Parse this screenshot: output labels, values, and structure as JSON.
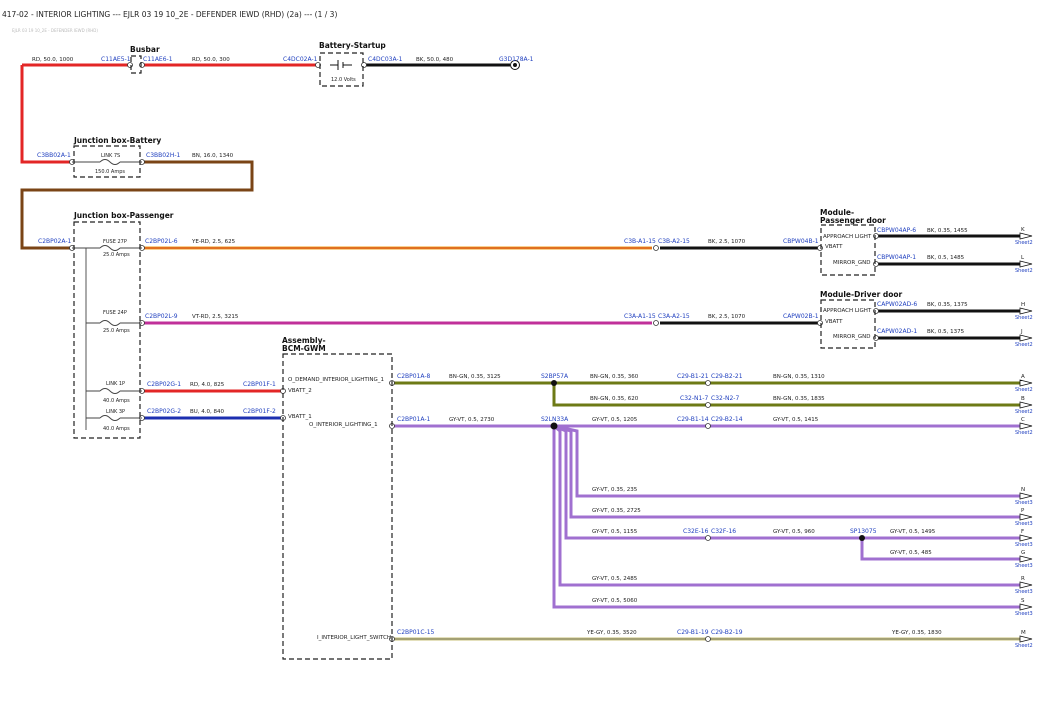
{
  "title": "417-02 - INTERIOR LIGHTING --- EJLR 03 19 10_2E - DEFENDER IEWD (RHD) (2a) --- (1 / 3)",
  "subtitle": "EJLR 03 19 10_2E - DEFENDER IEWD (RHD)",
  "colors": {
    "red": "#e32626",
    "brown": "#7a4416",
    "black": "#111111",
    "orange": "#f0a020",
    "magenta": "#c0309a",
    "blue": "#1c2fb0",
    "olive": "#6d7a16",
    "purple": "#a070d0",
    "yellow_grey": "#c8c27a",
    "connector_text": "#1f3fbf"
  },
  "blocks": {
    "busbar": "Busbar",
    "battery_startup": "Battery-Startup",
    "battery_voltage": "12.0 Volts",
    "jb_battery": "Junction box-Battery",
    "link7s": "LINK 7S",
    "link7s_rating": "150.0 Amps",
    "jb_passenger": "Junction box-Passenger",
    "fuse27p": "FUSE 27P",
    "fuse27p_rating": "25.0 Amps",
    "fuse24p": "FUSE 24P",
    "fuse24p_rating": "25.0 Amps",
    "link1p": "LINK 1P",
    "link1p_rating": "40.0 Amps",
    "link3p": "LINK 3P",
    "link3p_rating": "40.0 Amps",
    "assembly_l1": "Assembly-",
    "assembly_l2": "BCM-GWM",
    "pass_door_l1": "Module-",
    "pass_door_l2": "Passenger door",
    "drv_door": "Module-Driver door"
  },
  "pins": {
    "approach_light": "APPROACH LIGHT",
    "vbatt": "VBATT",
    "mirror_gnd": "MIRROR_GND",
    "o_demand": "O_DEMAND_INTERIOR_LIGHTING_1",
    "vbatt2": "VBATT_2",
    "vbatt1": "VBATT_1",
    "o_interior": "O_INTERIOR_LIGHTING_1",
    "i_switch": "I_INTERIOR_LIGHT_SWITCH"
  },
  "connectors": {
    "c11ae5_1": "C11AE5-1",
    "c11ae6_1": "C11AE6-1",
    "c4dc02a_1": "C4DC02A-1",
    "c4dc03a_1": "C4DC03A-1",
    "g3d178a_1": "G3D178A-1",
    "c3bb02a_1": "C3BB02A-1",
    "c3bb02h_1": "C3BB02H-1",
    "c2bp02a_1": "C2BP02A-1",
    "c2bp02l_6": "C2BP02L-6",
    "c3b_a1_15": "C3B-A1-15",
    "c3b_a2_15": "C3B-A2-15",
    "cbpw04b_1": "CBPW04B-1",
    "cbpw04ap_6": "CBPW04AP-6",
    "cbpw04ap_1": "CBPW04AP-1",
    "c2bp02l_9": "C2BP02L-9",
    "c3a_a1_15": "C3A-A1-15",
    "c3a_a2_15": "C3A-A2-15",
    "capw02b_1": "CAPW02B-1",
    "capw02ad_6": "CAPW02AD-6",
    "capw02ad_1": "CAPW02AD-1",
    "c2bp02g_1": "C2BP02G-1",
    "c2bp01f_1": "C2BP01F-1",
    "c2bp02g_2": "C2BP02G-2",
    "c2bp01f_2": "C2BP01F-2",
    "c2bp01a_8": "C2BP01A-8",
    "s2bp57a": "S2BP57A",
    "c29_b1_21": "C29-B1-21",
    "c29_b2_21": "C29-B2-21",
    "c32_n1_7": "C32-N1-7",
    "c32_n2_7": "C32-N2-7",
    "c2bp01a_1": "C2BP01A-1",
    "s2ln33a": "S2LN33A",
    "c29_b1_14": "C29-B1-14",
    "c29_b2_14": "C29-B2-14",
    "c32e_16": "C32E-16",
    "c32f_16": "C32F-16",
    "sp13075": "SP13075",
    "c2bp01c_15": "C2BP01C-15",
    "c29_b1_19": "C29-B1-19",
    "c29_b2_19": "C29-B2-19"
  },
  "wires": {
    "w_rd_50_1000": "RD, 50.0, 1000",
    "w_rd_50_300": "RD, 50.0, 300",
    "w_bk_50_480": "BK, 50.0, 480",
    "w_bn_16_1340": "BN, 16.0, 1340",
    "w_yerd_25_625": "YE-RD, 2.5, 625",
    "w_bk_25_1070a": "BK, 2.5, 1070",
    "w_bk_035_1455": "BK, 0.35, 1455",
    "w_bk_05_1485": "BK, 0.5, 1485",
    "w_vtrd_25_3215": "VT-RD, 2.5, 3215",
    "w_bk_25_1070b": "BK, 2.5, 1070",
    "w_bk_035_1375": "BK, 0.35, 1375",
    "w_bk_05_1375": "BK, 0.5, 1375",
    "w_rd_40_825": "RD, 4.0, 825",
    "w_bu_40_840": "BU, 4.0, 840",
    "w_bngn_035_3125": "BN-GN, 0.35, 3125",
    "w_bngn_035_360": "BN-GN, 0.35, 360",
    "w_bngn_035_1310": "BN-GN, 0.35, 1310",
    "w_bngn_035_620": "BN-GN, 0.35, 620",
    "w_bngn_035_1835": "BN-GN, 0.35, 1835",
    "w_gyvt_05_2730": "GY-VT, 0.5, 2730",
    "w_gyvt_05_1205": "GY-VT, 0.5, 1205",
    "w_gyvt_05_1415": "GY-VT, 0.5, 1415",
    "w_gyvt_035_235": "GY-VT, 0.35, 235",
    "w_gyvt_035_2725": "GY-VT, 0.35, 2725",
    "w_gyvt_05_1155": "GY-VT, 0.5, 1155",
    "w_gyvt_05_960": "GY-VT, 0.5, 960",
    "w_gyvt_05_1495": "GY-VT, 0.5, 1495",
    "w_gyvt_05_485": "GY-VT, 0.5, 485",
    "w_gyvt_05_2485": "GY-VT, 0.5, 2485",
    "w_gyvt_05_5060": "GY-VT, 0.5, 5060",
    "w_yegy_035_3520": "YE-GY, 0.35, 3520",
    "w_yegy_035_1830": "YE-GY, 0.35, 1830"
  },
  "refs": {
    "K": "K",
    "L": "L",
    "H": "H",
    "J": "J",
    "A": "A",
    "B": "B",
    "C": "C",
    "N": "N",
    "P": "P",
    "F": "F",
    "G": "G",
    "R": "R",
    "S": "S",
    "M": "M",
    "sheet2": "Sheet2",
    "sheet3": "Sheet3"
  }
}
